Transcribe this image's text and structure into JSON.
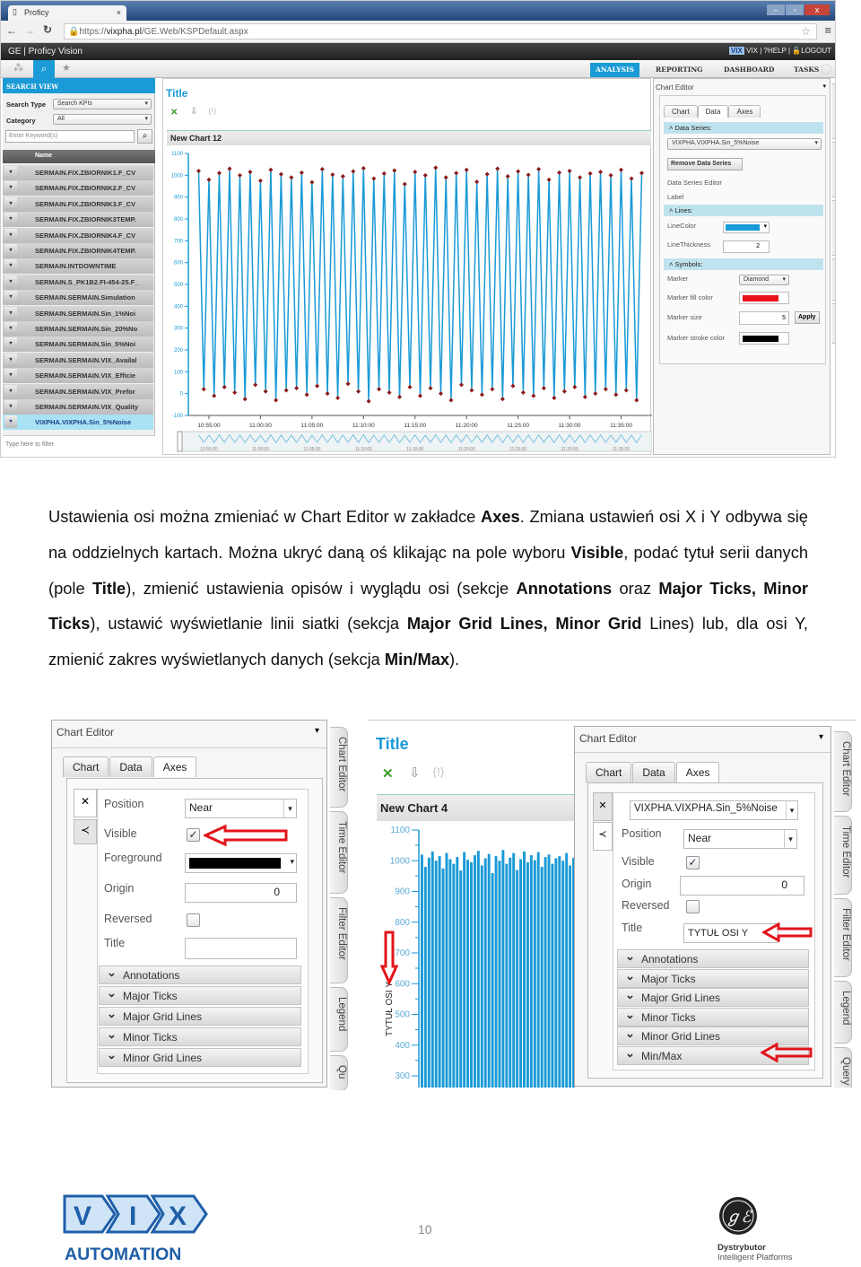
{
  "browser": {
    "tab_title": "Proficy",
    "tab_close": "×",
    "url_prefix": "https://",
    "url_domain": "vixpha.pl",
    "url_path": "/GE.Web/KSPDefault.aspx",
    "window_buttons": [
      "–",
      "▫",
      "x"
    ]
  },
  "app": {
    "brand": "GE | Proficy Vision",
    "user_links": [
      "VIX",
      "HELP",
      "LOGOUT"
    ],
    "nav_tabs": [
      "ANALYSIS",
      "REPORTING",
      "DASHBOARD",
      "TASKS"
    ],
    "active_tab": "ANALYSIS"
  },
  "search_view": {
    "header": "SEARCH VIEW",
    "search_type_label": "Search Type",
    "search_type_value": "Search KPIs",
    "category_label": "Category",
    "category_value": "All",
    "keyword_placeholder": "Enter Keyword(s)",
    "column_name": "Name",
    "items": [
      "SERMAIN.FIX.ZBIORNIK1.F_CV",
      "SERMAIN.FIX.ZBIORNIK2.F_CV",
      "SERMAIN.FIX.ZBIORNIK3.F_CV",
      "SERMAIN.FIX.ZBIORNIK3TEMP.",
      "SERMAIN.FIX.ZBIORNIK4.F_CV",
      "SERMAIN.FIX.ZBIORNIK4TEMP.",
      "SERMAIN.INTDOWNTIME",
      "SERMAIN.S_PK1B2.FI-454-25.F_",
      "SERMAIN.SERMAIN.Simulation",
      "SERMAIN.SERMAIN.Sin_1%Noi",
      "SERMAIN.SERMAIN.Sin_20%No",
      "SERMAIN.SERMAIN.Sin_5%Noi",
      "SERMAIN.SERMAIN.VIX_Availal",
      "SERMAIN.SERMAIN.VIX_Efficie",
      "SERMAIN.SERMAIN.VIX_Prefor",
      "SERMAIN.SERMAIN.VIX_Quality",
      "VIXPHA.VIXPHA.Sin_5%Noise"
    ],
    "selected_item": "VIXPHA.VIXPHA.Sin_5%Noise",
    "filter_placeholder": "Type here to filter"
  },
  "chart_panel": {
    "title": "Title",
    "chart_name": "New Chart 12"
  },
  "chart_editor": {
    "header": "Chart Editor",
    "tabs": [
      "Chart",
      "Data",
      "Axes"
    ],
    "active_tab": "Data",
    "data_series_header": "Data Series:",
    "data_series_value": "VIXPHA.VIXPHA.Sin_5%Noise",
    "remove_button": "Remove Data Series",
    "series_editor_label": "Data Series Editor",
    "label_label": "Label",
    "lines_header": "Lines:",
    "line_color_label": "LineColor",
    "line_color": "#1a9ad6",
    "line_thickness_label": "LineThickness",
    "line_thickness": "2",
    "symbols_header": "Symbols:",
    "marker_label": "Marker",
    "marker_value": "Diamond",
    "marker_fill_label": "Marker fill color",
    "marker_fill_color": "#e8141a",
    "marker_size_label": "Marker size",
    "marker_size": "5",
    "apply_button": "Apply",
    "marker_stroke_label": "Marker stroke color",
    "marker_stroke_color": "#000000"
  },
  "side_tabs": [
    "Chart Editor",
    "Time Editor",
    "Filter Editor",
    "Legend",
    "Query"
  ],
  "paragraph": {
    "p1": "Ustawienia osi można zmieniać w Chart Editor w zakładce ",
    "b1": "Axes",
    "p2": ". Zmiana ustawień osi X i Y odbywa się na oddzielnych kartach. Można ukryć daną oś klikając na pole wyboru ",
    "b2": "Visible",
    "p3": ", podać tytuł serii danych (pole ",
    "b3": "Title",
    "p4": "), zmienić ustawienia opisów i wyglądu osi (sekcje ",
    "b4": "Annotations",
    "p5": " oraz ",
    "b5": "Major Ticks, Minor Ticks",
    "p6": "),  ustawić wyświetlanie linii siatki (sekcja ",
    "b6": "Major Grid Lines, Minor Grid",
    "p7": " Lines) lub, dla osi Y, zmienić zakres wyświetlanych danych (sekcja ",
    "b7": "Min/Max",
    "p8": ")."
  },
  "axes_editor_x": {
    "header": "Chart Editor",
    "tabs": [
      "Chart",
      "Data",
      "Axes"
    ],
    "active_tab": "Axes",
    "axis_tabs": [
      "✕",
      "≺"
    ],
    "position_label": "Position",
    "position_value": "Near",
    "visible_label": "Visible",
    "visible_checked": true,
    "foreground_label": "Foreground",
    "foreground_color": "#000000",
    "origin_label": "Origin",
    "origin_value": "0",
    "reversed_label": "Reversed",
    "reversed_checked": false,
    "title_label": "Title",
    "title_value": "",
    "sections": [
      "Annotations",
      "Major Ticks",
      "Major Grid Lines",
      "Minor Ticks",
      "Minor Grid Lines"
    ],
    "side_tabs": [
      "Chart Editor",
      "Time Editor",
      "Filter Editor",
      "Legend",
      "Qu"
    ]
  },
  "axes_editor_y": {
    "chart_title": "Title",
    "chart_name": "New Chart 4",
    "header": "Chart Editor",
    "tabs": [
      "Chart",
      "Data",
      "Axes"
    ],
    "active_tab": "Axes",
    "axis_tabs": [
      "✕",
      "≺"
    ],
    "series_value": "VIXPHA.VIXPHA.Sin_5%Noise",
    "position_label": "Position",
    "position_value": "Near",
    "visible_label": "Visible",
    "visible_checked": true,
    "origin_label": "Origin",
    "origin_value": "0",
    "reversed_label": "Reversed",
    "reversed_checked": false,
    "title_label": "Title",
    "title_value": "TYTUŁ OSI Y",
    "sections": [
      "Annotations",
      "Major Ticks",
      "Major Grid Lines",
      "Minor Ticks",
      "Minor Grid Lines",
      "Min/Max"
    ],
    "side_tabs": [
      "Chart Editor",
      "Time Editor",
      "Filter Editor",
      "Legend",
      "Query"
    ]
  },
  "annotation_color": "#e3141b",
  "footer": {
    "page_number": "10",
    "left_logo_text": "VIX AUTOMATION",
    "right_logo_line1": "Dystrybutor",
    "right_logo_line2": "Intelligent Platforms"
  },
  "chart_data": [
    {
      "type": "line",
      "title": "New Chart 12",
      "ylim": [
        -100,
        1100
      ],
      "yticks": [
        "1100",
        "1000",
        "900",
        "800",
        "700",
        "600",
        "500",
        "400",
        "300",
        "200",
        "100",
        "0",
        "-100"
      ],
      "xticks": [
        "10:55:00",
        "11:00:00",
        "11:05:00",
        "11:10:00",
        "11:15:00",
        "11:20:00",
        "11:25:00",
        "11:30:00",
        "11:35:00"
      ],
      "navigator_ticks": [
        "10:55:00",
        "11:00:00",
        "11:05:00",
        "11:10:00",
        "11:15:00",
        "11:20:00",
        "11:25:00",
        "11:30:00",
        "11:35:00"
      ],
      "xlim": [
        "10:53:00",
        "11:38:00"
      ],
      "line_color": "#1a9ad6",
      "marker": "diamond",
      "marker_color": "#8b1a1a",
      "x": [
        "10:54:00",
        "10:54:30",
        "10:55:00",
        "10:55:30",
        "10:56:00",
        "10:56:30",
        "10:57:00",
        "10:57:30",
        "10:58:00",
        "10:58:30",
        "10:59:00",
        "10:59:30",
        "11:00:00",
        "11:00:30",
        "11:01:00",
        "11:01:30",
        "11:02:00",
        "11:02:30",
        "11:03:00",
        "11:03:30",
        "11:04:00",
        "11:04:30",
        "11:05:00",
        "11:05:30",
        "11:06:00",
        "11:06:30",
        "11:07:00",
        "11:07:30",
        "11:08:00",
        "11:08:30",
        "11:09:00",
        "11:09:30",
        "11:10:00",
        "11:10:30",
        "11:11:00",
        "11:11:30",
        "11:12:00",
        "11:12:30",
        "11:13:00",
        "11:13:30",
        "11:14:00",
        "11:14:30",
        "11:15:00",
        "11:15:30",
        "11:16:00",
        "11:16:30",
        "11:17:00",
        "11:17:30",
        "11:18:00",
        "11:18:30",
        "11:19:00",
        "11:19:30",
        "11:20:00",
        "11:20:30",
        "11:21:00",
        "11:21:30",
        "11:22:00",
        "11:22:30",
        "11:23:00",
        "11:23:30",
        "11:24:00",
        "11:24:30",
        "11:25:00",
        "11:25:30",
        "11:26:00",
        "11:26:30",
        "11:27:00",
        "11:27:30",
        "11:28:00",
        "11:28:30",
        "11:29:00",
        "11:29:30",
        "11:30:00",
        "11:30:30",
        "11:31:00",
        "11:31:30",
        "11:32:00",
        "11:32:30",
        "11:33:00",
        "11:33:30",
        "11:34:00",
        "11:34:30",
        "11:35:00",
        "11:35:30",
        "11:36:00",
        "11:36:30",
        "11:37:00"
      ],
      "y": [
        1020,
        20,
        980,
        -10,
        1010,
        30,
        1030,
        5,
        1000,
        -25,
        1015,
        40,
        975,
        10,
        1025,
        -30,
        1005,
        15,
        990,
        25,
        1012,
        -5,
        968,
        35,
        1028,
        0,
        1003,
        -20,
        995,
        45,
        1018,
        10,
        1032,
        -35,
        985,
        20,
        1008,
        5,
        1022,
        -15,
        960,
        30,
        1015,
        -10,
        1000,
        25,
        1035,
        0,
        990,
        -30,
        1010,
        40,
        1025,
        15,
        970,
        -5,
        1005,
        20,
        1030,
        -25,
        995,
        35,
        1018,
        5,
        1002,
        -10,
        1028,
        25,
        980,
        -20,
        1012,
        10,
        1020,
        30,
        990,
        -15,
        1008,
        0,
        1015,
        20,
        1000,
        -5,
        1025,
        15,
        985,
        -30,
        1010
      ]
    },
    {
      "type": "bar",
      "title": "New Chart 4",
      "ylabel": "TYTUŁ OSI Y",
      "ylim": [
        300,
        1100
      ],
      "yticks": [
        "1100",
        "1000",
        "900",
        "800",
        "700",
        "600",
        "500",
        "400",
        "300"
      ],
      "color": "#1a9ad6",
      "values": [
        1020,
        980,
        1010,
        1030,
        1000,
        1015,
        975,
        1025,
        1005,
        990,
        1012,
        968,
        1028,
        1003,
        995,
        1018,
        1032,
        985,
        1008,
        1022,
        960,
        1015,
        1000,
        1035,
        990,
        1010,
        1025,
        970,
        1005,
        1030,
        995,
        1018,
        1002,
        1028,
        980,
        1012,
        1020,
        990,
        1008,
        1015,
        1000,
        1025,
        985,
        1010
      ]
    }
  ]
}
